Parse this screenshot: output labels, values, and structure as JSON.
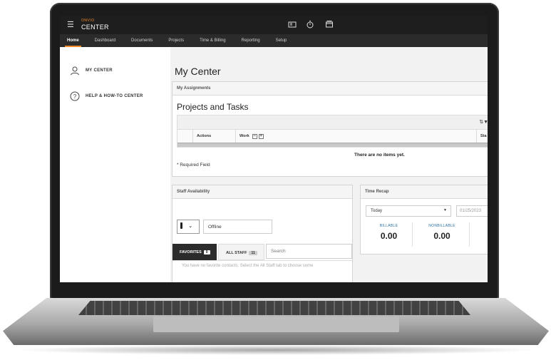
{
  "app": {
    "brand_small": "ONVIO",
    "brand": "CENTER"
  },
  "nav": {
    "items": [
      "Home",
      "Dashboard",
      "Documents",
      "Projects",
      "Time & Billing",
      "Reporting",
      "Setup"
    ],
    "active": "Home"
  },
  "sidebar": {
    "items": [
      {
        "label": "MY CENTER",
        "icon": "user-icon"
      },
      {
        "label": "HELP & HOW-TO CENTER",
        "icon": "help-circle-icon"
      }
    ]
  },
  "main": {
    "title": "My Center",
    "assignments": {
      "header": "My Assignments",
      "title": "Projects and Tasks",
      "columns": [
        "Actions",
        "Work",
        "Sta"
      ],
      "empty_message": "There are no items yet.",
      "required_note": "* Required Field"
    },
    "staff": {
      "header": "Staff Availability",
      "status_value": "Offline",
      "tabs": [
        {
          "label": "FAVORITES",
          "count": "0"
        },
        {
          "label": "ALL STAFF",
          "count": "11"
        }
      ],
      "search_placeholder": "Search",
      "favorites_message": "You have no favorite contacts. Select the All Staff tab to choose some"
    },
    "time_recap": {
      "header": "Time Recap",
      "period": "Today",
      "date": "01/25/2023",
      "metrics": [
        {
          "label": "BILLABLE",
          "value": "0.00"
        },
        {
          "label": "NONBILLABLE",
          "value": "0.00"
        }
      ]
    }
  },
  "colors": {
    "accent": "#f08b2c",
    "topbar": "#1e1e1e",
    "navbar": "#2b2b2b",
    "metric_label": "#2a6fa0"
  }
}
